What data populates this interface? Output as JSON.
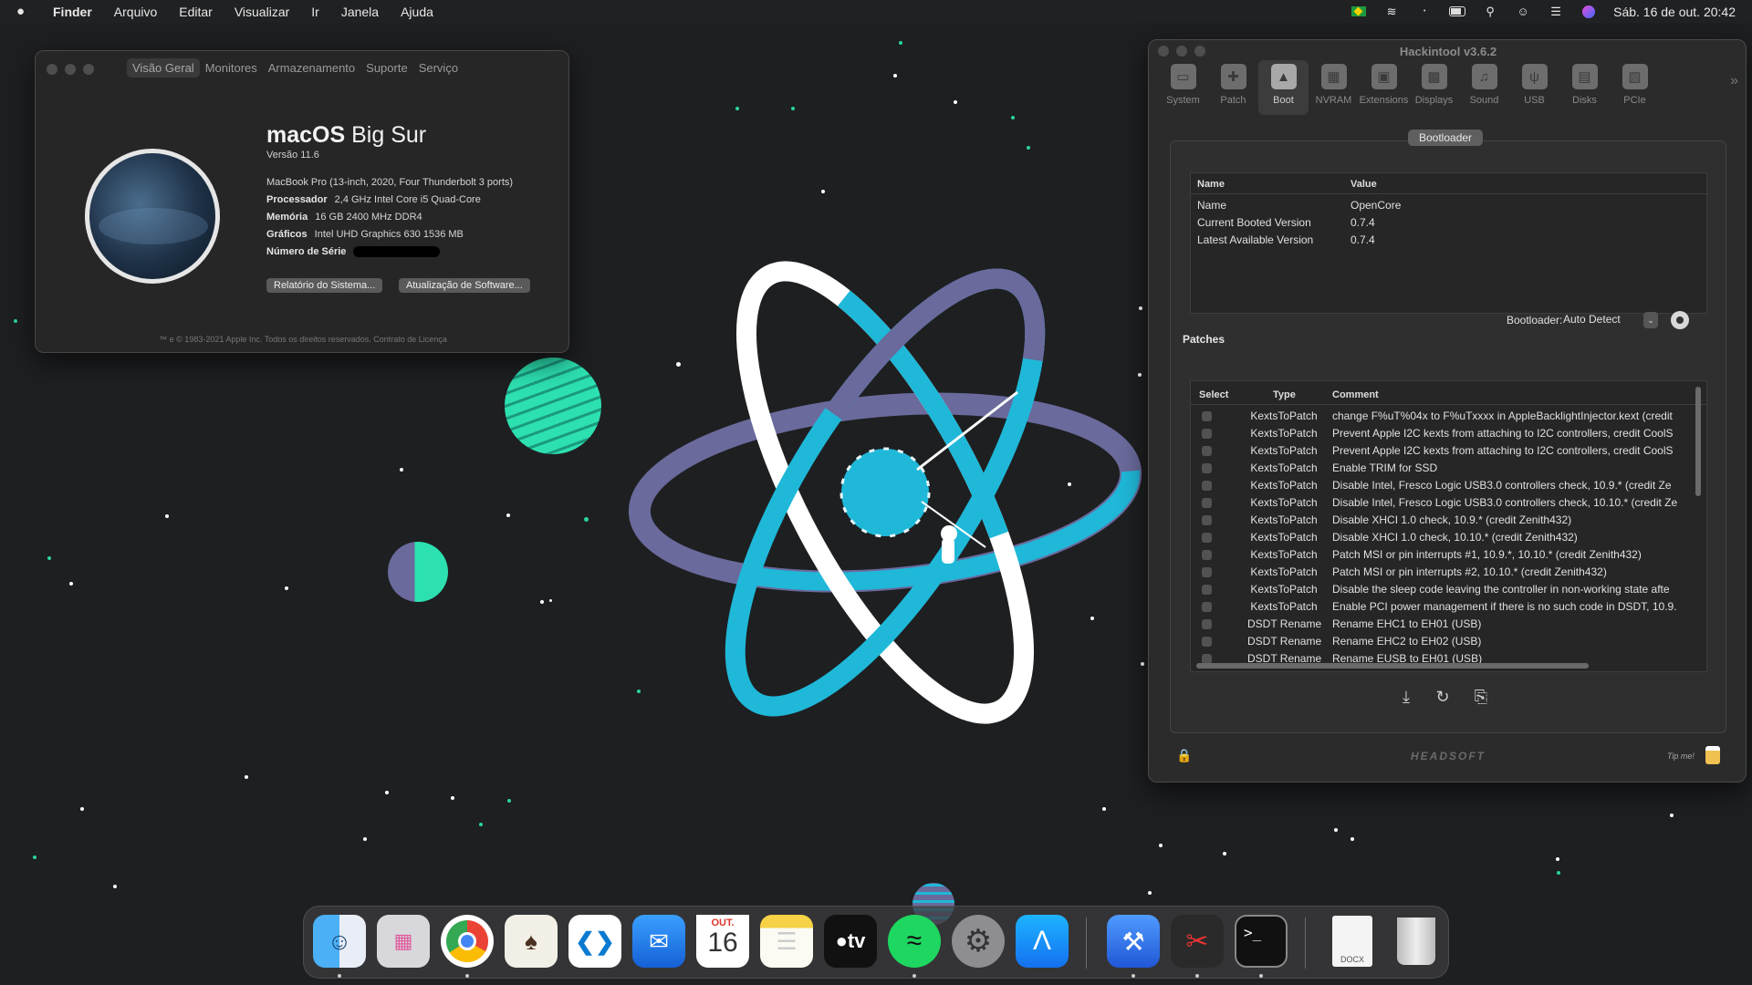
{
  "menubar": {
    "apple": "",
    "items": [
      "Finder",
      "Arquivo",
      "Editar",
      "Visualizar",
      "Ir",
      "Janela",
      "Ajuda"
    ],
    "clock": "Sáb. 16 de out.  20:42",
    "status_icons": [
      "flag-icon",
      "wifi-icon",
      "bluetooth-icon",
      "battery-icon",
      "search-icon",
      "user-icon",
      "control-center-icon",
      "siri-icon"
    ]
  },
  "about": {
    "tabs": [
      "Visão Geral",
      "Monitores",
      "Armazenamento",
      "Suporte",
      "Serviço"
    ],
    "os_name_bold": "macOS",
    "os_name_rest": " Big Sur",
    "version": "Versão 11.6",
    "model": "MacBook Pro (13-inch, 2020, Four Thunderbolt 3 ports)",
    "specs": [
      {
        "label": "Processador",
        "value": "2,4 GHz Intel Core i5 Quad-Core"
      },
      {
        "label": "Memória",
        "value": "16 GB 2400 MHz DDR4"
      },
      {
        "label": "Gráficos",
        "value": "Intel UHD Graphics 630 1536 MB"
      },
      {
        "label": "Número de Série",
        "value": ""
      }
    ],
    "btn_report": "Relatório do Sistema...",
    "btn_update": "Atualização de Software...",
    "footer": "™ e © 1983-2021 Apple Inc. Todos os direitos reservados. Contrato de Licença"
  },
  "hackintool": {
    "title": "Hackintool v3.6.2",
    "toolbar": [
      "System",
      "Patch",
      "Boot",
      "NVRAM",
      "Extensions",
      "Displays",
      "Sound",
      "USB",
      "Disks",
      "PCIe"
    ],
    "active_tab": "Boot",
    "section_tab": "Bootloader",
    "info_headers": [
      "Name",
      "Value"
    ],
    "info_rows": [
      [
        "Name",
        "OpenCore"
      ],
      [
        "Current Booted Version",
        "0.7.4"
      ],
      [
        "Latest Available Version",
        "0.7.4"
      ]
    ],
    "bootloader_label": "Bootloader:",
    "bootloader_value": "Auto Detect",
    "patches_title": "Patches",
    "patch_headers": [
      "Select",
      "Type",
      "Comment"
    ],
    "patches": [
      [
        "KextsToPatch",
        "change F%uT%04x to F%uTxxxx in AppleBacklightInjector.kext (credit"
      ],
      [
        "KextsToPatch",
        "Prevent Apple I2C kexts from attaching to I2C controllers, credit CoolS"
      ],
      [
        "KextsToPatch",
        "Prevent Apple I2C kexts from attaching to I2C controllers, credit CoolS"
      ],
      [
        "KextsToPatch",
        "Enable TRIM for SSD"
      ],
      [
        "KextsToPatch",
        "Disable Intel, Fresco Logic USB3.0 controllers check, 10.9.* (credit Ze"
      ],
      [
        "KextsToPatch",
        "Disable Intel, Fresco Logic USB3.0 controllers check, 10.10.* (credit Ze"
      ],
      [
        "KextsToPatch",
        "Disable XHCI 1.0 check, 10.9.* (credit Zenith432)"
      ],
      [
        "KextsToPatch",
        "Disable XHCI 1.0 check, 10.10.* (credit Zenith432)"
      ],
      [
        "KextsToPatch",
        "Patch MSI or pin interrupts #1, 10.9.*, 10.10.* (credit Zenith432)"
      ],
      [
        "KextsToPatch",
        "Patch MSI or pin interrupts #2, 10.10.* (credit Zenith432)"
      ],
      [
        "KextsToPatch",
        "Disable the sleep code leaving the controller in non-working state afte"
      ],
      [
        "KextsToPatch",
        "Enable PCI power management if there is no such code in DSDT, 10.9."
      ],
      [
        "DSDT Rename",
        "Rename EHC1 to EH01 (USB)"
      ],
      [
        "DSDT Rename",
        "Rename EHC2 to EH02 (USB)"
      ],
      [
        "DSDT Rename",
        "Rename EUSB to EH01 (USB)"
      ]
    ],
    "brand": "HEADSOFT",
    "tip": "Tip me!"
  },
  "dock": {
    "apps": [
      "Finder",
      "Launchpad",
      "Google Chrome",
      "CotEditor",
      "Visual Studio Code",
      "Mail",
      "Calendar",
      "Notes",
      "Apple TV",
      "Spotify",
      "System Preferences",
      "App Store",
      "Xcode",
      "Scissors App",
      "Terminal",
      "Document",
      "Trash"
    ],
    "calendar_month": "OUT.",
    "calendar_day": "16",
    "tv_label": "tv",
    "docx_label": "DOCX"
  },
  "colors": {
    "accent_cyan": "#1fb8d8",
    "ring_purple": "#6a6a9c",
    "planet_green": "#2de0b0",
    "star_green": "#2ad4a0"
  }
}
